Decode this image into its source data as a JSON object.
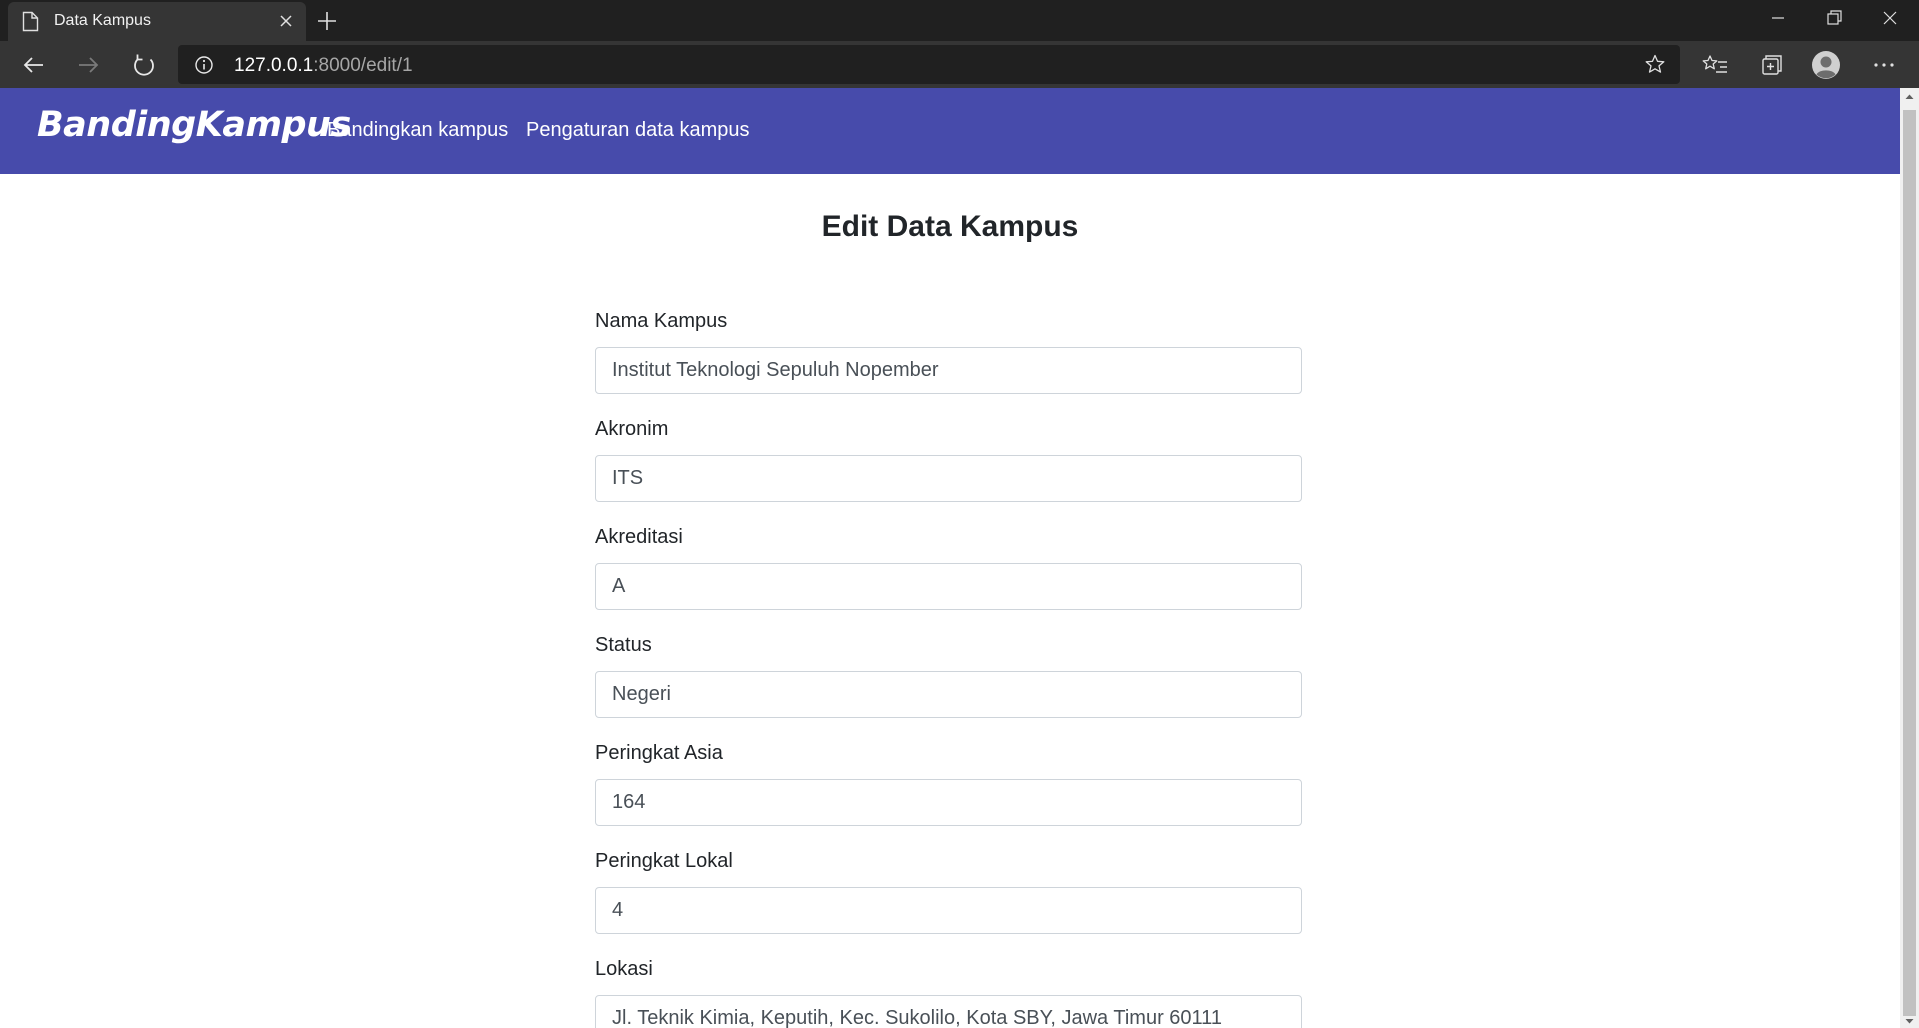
{
  "browser": {
    "tab_title": "Data Kampus",
    "url_host": "127.0.0.1",
    "url_path": ":8000/edit/1"
  },
  "site": {
    "brand": "BandingKampus",
    "nav": [
      "Bandingkan kampus",
      "Pengaturan data kampus"
    ],
    "header_color": "#474bab"
  },
  "page": {
    "title": "Edit Data Kampus"
  },
  "form": {
    "fields": [
      {
        "label": "Nama Kampus",
        "value": "Institut Teknologi Sepuluh Nopember"
      },
      {
        "label": "Akronim",
        "value": "ITS"
      },
      {
        "label": "Akreditasi",
        "value": "A"
      },
      {
        "label": "Status",
        "value": "Negeri"
      },
      {
        "label": "Peringkat Asia",
        "value": "164"
      },
      {
        "label": "Peringkat Lokal",
        "value": "4"
      },
      {
        "label": "Lokasi",
        "value": "Jl. Teknik Kimia, Keputih, Kec. Sukolilo, Kota SBY, Jawa Timur 60111"
      }
    ]
  },
  "icons": [
    "page-icon",
    "close-icon",
    "plus-icon",
    "minimize-icon",
    "restore-icon",
    "window-close-icon",
    "back-arrow-icon",
    "forward-arrow-icon",
    "refresh-icon",
    "info-icon",
    "star-icon",
    "favorites-icon",
    "collections-icon",
    "profile-icon",
    "more-icon"
  ]
}
